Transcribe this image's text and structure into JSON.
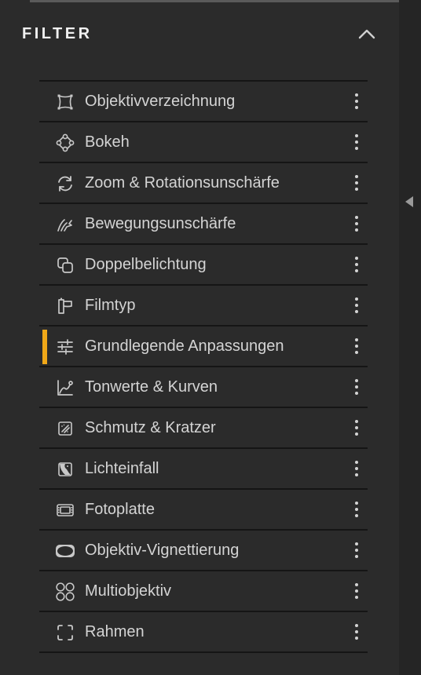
{
  "panel": {
    "title": "FILTER",
    "collapse_icon": "chevron-up-icon",
    "rail_icon": "caret-left-icon"
  },
  "accent_color": "#f0a818",
  "filters": [
    {
      "label": "Objektivverzeichnung",
      "icon": "lens-distortion-icon",
      "active": false
    },
    {
      "label": "Bokeh",
      "icon": "bokeh-icon",
      "active": false
    },
    {
      "label": "Zoom & Rotationsunschärfe",
      "icon": "zoom-rotation-icon",
      "active": false
    },
    {
      "label": "Bewegungsunschärfe",
      "icon": "motion-blur-icon",
      "active": false
    },
    {
      "label": "Doppelbelichtung",
      "icon": "double-exposure-icon",
      "active": false
    },
    {
      "label": "Filmtyp",
      "icon": "film-type-icon",
      "active": false
    },
    {
      "label": "Grundlegende Anpassungen",
      "icon": "sliders-icon",
      "active": true
    },
    {
      "label": "Tonwerte & Kurven",
      "icon": "curves-icon",
      "active": false
    },
    {
      "label": "Schmutz & Kratzer",
      "icon": "dust-scratches-icon",
      "active": false
    },
    {
      "label": "Lichteinfall",
      "icon": "light-leak-icon",
      "active": false
    },
    {
      "label": "Fotoplatte",
      "icon": "photo-plate-icon",
      "active": false
    },
    {
      "label": "Objektiv-Vignettierung",
      "icon": "vignette-icon",
      "active": false
    },
    {
      "label": "Multiobjektiv",
      "icon": "multi-lens-icon",
      "active": false
    },
    {
      "label": "Rahmen",
      "icon": "frame-icon",
      "active": false
    }
  ]
}
